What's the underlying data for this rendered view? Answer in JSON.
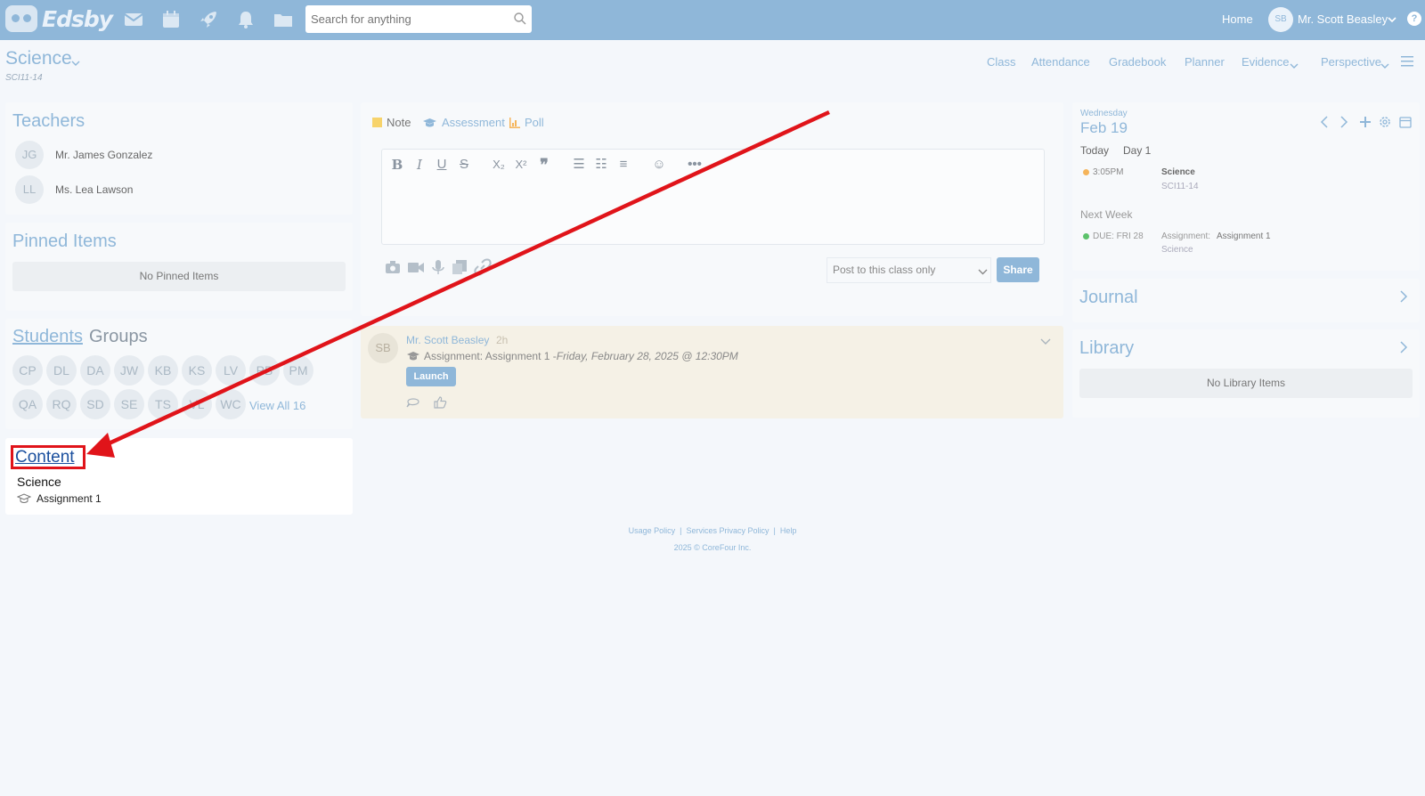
{
  "topbar": {
    "logo_text": "Edsby",
    "search_placeholder": "Search for anything",
    "home_label": "Home",
    "user_initials": "SB",
    "user_name": "Mr. Scott Beasley",
    "help_label": "?",
    "icons": [
      "mail-icon",
      "calendar-icon",
      "rocket-icon",
      "bell-icon",
      "folder-icon"
    ]
  },
  "course": {
    "title": "Science",
    "code": "SCI11-14"
  },
  "nav_tabs": {
    "class": "Class",
    "attendance": "Attendance",
    "gradebook": "Gradebook",
    "planner": "Planner",
    "evidence": "Evidence",
    "perspective": "Perspective"
  },
  "teachers": {
    "title": "Teachers",
    "items": [
      {
        "initials": "JG",
        "name": "Mr. James Gonzalez"
      },
      {
        "initials": "LL",
        "name": "Ms. Lea Lawson"
      }
    ]
  },
  "pinned": {
    "title": "Pinned Items",
    "empty": "No Pinned Items"
  },
  "students": {
    "title_link": "Students",
    "title_groups": "Groups",
    "row1": [
      "CP",
      "DL",
      "DA",
      "JW",
      "KB",
      "KS",
      "LV",
      "PB",
      "PM"
    ],
    "row2": [
      "QA",
      "RQ",
      "SD",
      "SE",
      "TS",
      "VL",
      "WC"
    ],
    "view_all": "View All 16"
  },
  "content": {
    "title": "Content",
    "course": "Science",
    "item": "Assignment 1"
  },
  "composer": {
    "note": "Note",
    "assessment": "Assessment",
    "poll": "Poll",
    "audience": "Post to this class only",
    "share": "Share"
  },
  "feed": {
    "author_initials": "SB",
    "author": "Mr. Scott Beasley",
    "time": "2h",
    "text": "Assignment: Assignment 1 - ",
    "due": "Friday, February 28, 2025 @ 12:30PM",
    "launch": "Launch"
  },
  "calendar": {
    "weekday": "Wednesday",
    "date": "Feb 19",
    "today": "Today",
    "day_label": "Day 1",
    "event_time": "3:05PM",
    "event_title": "Science",
    "event_code": "SCI11-14",
    "next_week": "Next Week",
    "due_label": "DUE: FRI 28",
    "due_prefix": "Assignment: ",
    "due_title": "Assignment 1",
    "due_course": "Science",
    "colors": {
      "event_dot": "#f5b45a",
      "due_dot": "#5cc26b"
    }
  },
  "journal": {
    "title": "Journal"
  },
  "library": {
    "title": "Library",
    "empty": "No Library Items"
  },
  "footer": {
    "usage": "Usage Policy",
    "privacy": "Services Privacy Policy",
    "help": "Help",
    "sep": "|",
    "copyright": "2025 © CoreFour Inc."
  },
  "colors": {
    "topbar": "#8fb7d9",
    "accent": "#8fb7d9",
    "highlight_box": "#e0141a",
    "arrow": "#e0141a",
    "content_link": "#1a4f9e"
  }
}
